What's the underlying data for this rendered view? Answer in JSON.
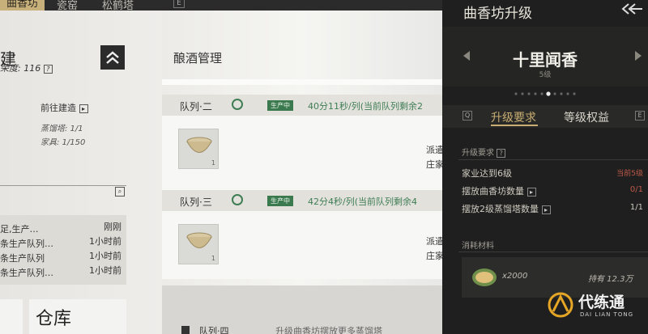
{
  "topbar": {
    "tabs": [
      "曲香坊",
      "瓷窑",
      "松鹤塔"
    ],
    "key": "E"
  },
  "left": {
    "title": "建",
    "prosperity_label": "荣度:",
    "prosperity_value": "116",
    "help": "?",
    "goto_build": "前往建造",
    "still_count": "蒸馏塔: 1/1",
    "furniture": "家具: 1/150",
    "logs": [
      {
        "text": "足,生产…",
        "time": "刚刚"
      },
      {
        "text": "条生产队列…",
        "time": "1小时前"
      },
      {
        "text": "条生产队列",
        "time": "1小时前"
      },
      {
        "text": "条生产队列…",
        "time": "1小时前"
      }
    ],
    "warehouse": "仓库"
  },
  "mid": {
    "title": "酿酒管理",
    "queues": [
      {
        "name": "队列·二",
        "status": "生产中",
        "time": "40分11秒/列(当前队列剩余2",
        "dispatch": "派遣",
        "dispatch2": "庄家",
        "count": "1"
      },
      {
        "name": "队列·三",
        "status": "生产中",
        "time": "42分4秒/列(当前队列剩余4",
        "dispatch": "派遣",
        "dispatch2": "庄家",
        "count": "1"
      }
    ],
    "queue4": {
      "name": "队列·四",
      "hint": "升级曲香坊摆放更多蒸馏塔"
    }
  },
  "right": {
    "title": "曲香坊升级",
    "wine_name": "十里闻香",
    "level": "5级",
    "tab_left_key": "Q",
    "tab_right_key": "E",
    "tabs": [
      "升级要求",
      "等级权益"
    ],
    "req_heading": "升级要求",
    "requirements": [
      {
        "label": "家业达到6级",
        "value": "当前5级",
        "warn": true
      },
      {
        "label": "摆放曲香坊数量",
        "value": "0/1",
        "warn": true
      },
      {
        "label": "摆放2级蒸馏塔数量",
        "value": "1/1",
        "warn": false
      }
    ],
    "materials_heading": "消耗材料",
    "material": {
      "amount": "x2000",
      "own": "持有 12.3万"
    },
    "watermark": {
      "cn": "代练通",
      "en": "DAI LIAN TONG"
    }
  },
  "colors": {
    "gold": "#c9ad72",
    "green": "#3b7a4e",
    "warn": "#c05a4a"
  }
}
